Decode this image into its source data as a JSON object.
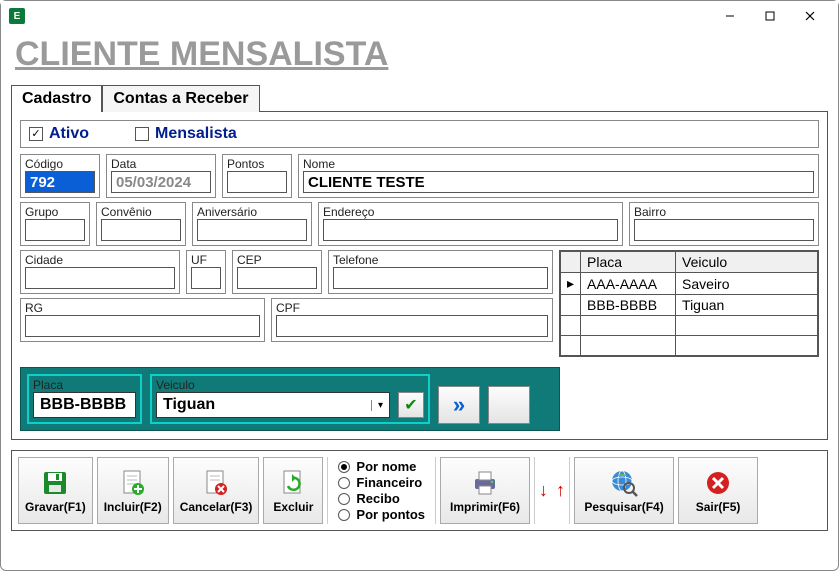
{
  "window": {
    "appicon_letter": "E"
  },
  "page": {
    "title": "CLIENTE MENSALISTA"
  },
  "tabs": {
    "cadastro": "Cadastro",
    "contas": "Contas a Receber"
  },
  "flags": {
    "ativo_label": "Ativo",
    "ativo_checked": "✓",
    "mensalista_label": "Mensalista"
  },
  "fields": {
    "codigo_label": "Código",
    "codigo_value": "792",
    "data_label": "Data",
    "data_value": "05/03/2024",
    "pontos_label": "Pontos",
    "pontos_value": "",
    "nome_label": "Nome",
    "nome_value": "CLIENTE TESTE",
    "grupo_label": "Grupo",
    "grupo_value": "",
    "convenio_label": "Convênio",
    "convenio_value": "",
    "aniversario_label": "Aniversário",
    "aniversario_value": "",
    "endereco_label": "Endereço",
    "endereco_value": "",
    "bairro_label": "Bairro",
    "bairro_value": "",
    "cidade_label": "Cidade",
    "cidade_value": "",
    "uf_label": "UF",
    "uf_value": "",
    "cep_label": "CEP",
    "cep_value": "",
    "telefone_label": "Telefone",
    "telefone_value": "",
    "rg_label": "RG",
    "rg_value": "",
    "cpf_label": "CPF",
    "cpf_value": ""
  },
  "grid": {
    "col_placa": "Placa",
    "col_veiculo": "Veiculo",
    "rows": [
      {
        "ptr": "▸",
        "placa": "AAA-AAAA",
        "veiculo": "Saveiro"
      },
      {
        "ptr": "",
        "placa": "BBB-BBBB",
        "veiculo": "Tiguan"
      }
    ]
  },
  "veh": {
    "placa_label": "Placa",
    "placa_value": "BBB-BBBB",
    "veiculo_label": "Veiculo",
    "veiculo_value": "Tiguan",
    "next_glyph": "»"
  },
  "radios": {
    "por_nome": "Por nome",
    "financeiro": "Financeiro",
    "recibo": "Recibo",
    "por_pontos": "Por pontos"
  },
  "toolbar": {
    "gravar": "Gravar(F1)",
    "incluir": "Incluir(F2)",
    "cancelar": "Cancelar(F3)",
    "excluir": "Excluir",
    "imprimir": "Imprimir(F6)",
    "pesquisar": "Pesquisar(F4)",
    "sair": "Sair(F5)"
  }
}
